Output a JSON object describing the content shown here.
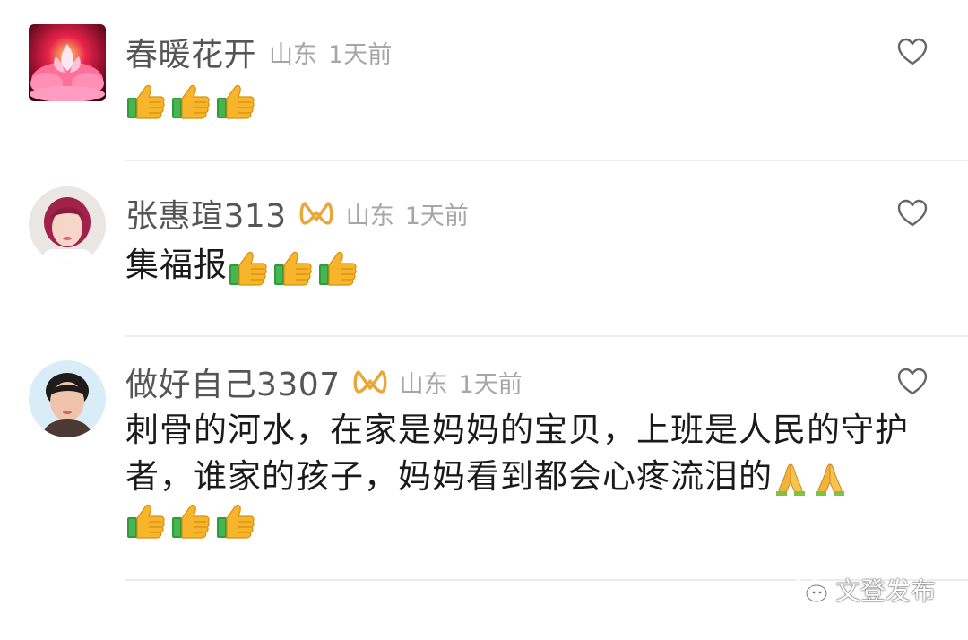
{
  "comments": [
    {
      "name": "春暖花开",
      "location": "山东",
      "time": "1天前",
      "verified_badge": false,
      "text": "",
      "emoji_rows": [
        [
          "thumbs-up",
          "thumbs-up",
          "thumbs-up"
        ]
      ]
    },
    {
      "name": "张惠瑄313",
      "location": "山东",
      "time": "1天前",
      "verified_badge": true,
      "text": "集福报",
      "emoji_inline": [
        "thumbs-up",
        "thumbs-up",
        "thumbs-up"
      ]
    },
    {
      "name": "做好自己3307",
      "location": "山东",
      "time": "1天前",
      "verified_badge": true,
      "text": "刺骨的河水，在家是妈妈的宝贝，上班是人民的守护者，谁家的孩子，妈妈看到都会心疼流泪的",
      "emoji_inline": [
        "folded-hands",
        "folded-hands"
      ],
      "emoji_rows": [
        [
          "thumbs-up",
          "thumbs-up",
          "thumbs-up"
        ]
      ]
    }
  ],
  "watermark": "文登发布",
  "colors": {
    "name_text": "#555555",
    "meta_text": "#a6a6a6",
    "badge": "#e8a838",
    "divider": "#ececec"
  }
}
